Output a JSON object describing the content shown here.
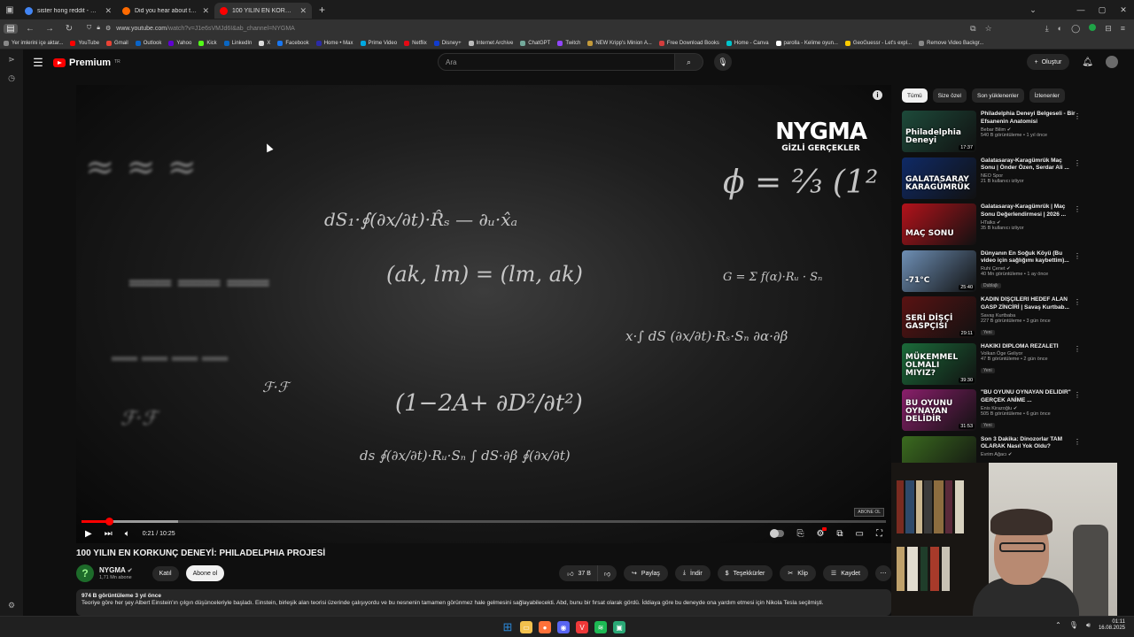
{
  "browser": {
    "tabs": [
      {
        "title": "sister hong reddit - Google Search",
        "favicon_color": "#4285f4",
        "active": false
      },
      {
        "title": "Did you hear about the Sister Hong",
        "favicon_color": "#ff6a00",
        "active": false
      },
      {
        "title": "100 YILIN EN KORKUNÇ DENEYİ",
        "favicon_color": "#ff0000",
        "active": true
      }
    ],
    "url_host": "www.youtube.com",
    "url_path": "/watch?v=J1e6sVMJd6I&ab_channel=NYGMA",
    "bookmarks": [
      {
        "label": "Yer imlerini içe aktar...",
        "color": "#888888"
      },
      {
        "label": "YouTube",
        "color": "#ff0000"
      },
      {
        "label": "Gmail",
        "color": "#ea4335"
      },
      {
        "label": "Outlook",
        "color": "#0a64c8"
      },
      {
        "label": "Yahoo",
        "color": "#6001d2"
      },
      {
        "label": "Kick",
        "color": "#53fc18"
      },
      {
        "label": "LinkedIn",
        "color": "#0a66c2"
      },
      {
        "label": "X",
        "color": "#dddddd"
      },
      {
        "label": "Facebook",
        "color": "#1877f2"
      },
      {
        "label": "Home • Max",
        "color": "#2b2ba8"
      },
      {
        "label": "Prime Video",
        "color": "#00a8e1"
      },
      {
        "label": "Netflix",
        "color": "#e50914"
      },
      {
        "label": "Disney+",
        "color": "#113ccf"
      },
      {
        "label": "Internet Archive",
        "color": "#bbbbbb"
      },
      {
        "label": "ChatGPT",
        "color": "#74aa9c"
      },
      {
        "label": "Twitch",
        "color": "#9146ff"
      },
      {
        "label": "NEW Kripp's Minion A...",
        "color": "#c49a3a"
      },
      {
        "label": "Free Download Books",
        "color": "#d33d3d"
      },
      {
        "label": "Home - Canva",
        "color": "#00c4cc"
      },
      {
        "label": "parolla - Kelime oyun...",
        "color": "#ffffff"
      },
      {
        "label": "GeoGuessr - Let's expl...",
        "color": "#ffcc00"
      },
      {
        "label": "Remove Video Backgr...",
        "color": "#888888"
      }
    ]
  },
  "header": {
    "logo_text": "Premium",
    "logo_region": "TR",
    "search_placeholder": "Ara",
    "create_label": "Oluştur"
  },
  "player": {
    "brand_line1": "NYGMA",
    "brand_line2": "GİZLİ GERÇEKLER",
    "current_time": "0:21",
    "duration": "10:25",
    "time_text": "0:21 / 10:25",
    "played_fraction": 0.034,
    "buffered_fraction": 0.12,
    "corner_tag": "ABONE OL"
  },
  "video": {
    "title": "100 YILIN EN KORKUNÇ DENEYİ: PHILADELPHIA PROJESİ",
    "channel_name": "NYGMA",
    "subscribers": "1,71 Mn abone",
    "join_label": "Katıl",
    "subscribe_label": "Abone ol",
    "likes": "37 B",
    "share_label": "Paylaş",
    "download_label": "İndir",
    "thanks_label": "Teşekkürler",
    "clip_label": "Klip",
    "save_label": "Kaydet",
    "views_date": "974 B görüntüleme  3 yıl önce",
    "description": "Teoriye göre her şey Albert Einstein'ın çılgın düşünceleriyle başladı. Einstein, birleşik alan teorisi üzerinde çalışıyordu ve bu nesnenin tamamen görünmez hale gelmesini sağlayabilecekti. Abd, bunu bir fırsat olarak gördü. İddiaya göre bu deneyde ona yardım etmesi için Nikola Tesla seçilmişti."
  },
  "chips": [
    "Tümü",
    "Size özel",
    "Son yüklenenler",
    "İzlenenler"
  ],
  "recommendations": [
    {
      "title": "Philadelphia Deneyi Belgeseli - Bir Efsanenin Anatomisi",
      "channel": "Bebar Bilim",
      "verified": true,
      "stats": "540 B görüntüleme • 1 yıl önce",
      "duration": "17:37",
      "badge": "",
      "thumb_color": "#1d4a3a",
      "thumb_text": "Philadelphia Deneyi"
    },
    {
      "title": "Galatasaray-Karagümrük Maç Sonu | Önder Özen, Serdar Ali ...",
      "channel": "NEO Spor",
      "verified": false,
      "stats": "21 B kullanıcı izliyor",
      "duration": "",
      "badge": "",
      "thumb_color": "#0f2a66",
      "thumb_text": "GALATASARAY KARAGÜMRÜK"
    },
    {
      "title": "Galatasaray-Karagümrük | Maç Sonu Değerlendirmesi | 2026 ...",
      "channel": "HTalks",
      "verified": true,
      "stats": "35 B kullanıcı izliyor",
      "duration": "",
      "badge": "",
      "thumb_color": "#b3121b",
      "thumb_text": "MAÇ SONU"
    },
    {
      "title": "Dünyanın En Soğuk Köyü (Bu video için sağlığımı kaybettim)...",
      "channel": "Ruhi Çenet",
      "verified": true,
      "stats": "40 Mn görüntüleme • 1 ay önce",
      "duration": "25:40",
      "badge": "Dublajlı",
      "thumb_color": "#6e8fb5",
      "thumb_text": "-71°C"
    },
    {
      "title": "KADIN DİŞÇİLERİ HEDEF ALAN GASP ZİNCİRİ | Savaş Kurtbab...",
      "channel": "Savaş Kurtbaba",
      "verified": false,
      "stats": "227 B görüntüleme • 3 gün önce",
      "duration": "29:11",
      "badge": "Yeni",
      "thumb_color": "#5a1212",
      "thumb_text": "SERİ DİŞÇİ GASPÇISI"
    },
    {
      "title": "HAKİKİ DİPLOMA REZALETİ",
      "channel": "Volkan Öge Geliyor",
      "verified": false,
      "stats": "47 B görüntüleme • 2 gün önce",
      "duration": "39:30",
      "badge": "Yeni",
      "thumb_color": "#1b6b3a",
      "thumb_text": "MÜKEMMEL OLMALI MIYIZ?"
    },
    {
      "title": "\"BU OYUNU OYNAYAN DELİDİR\" GERÇEK ANİME ...",
      "channel": "Enis Kirazoğlu",
      "verified": true,
      "stats": "505 B görüntüleme • 6 gün önce",
      "duration": "31:53",
      "badge": "Yeni",
      "thumb_color": "#8a1f6b",
      "thumb_text": "BU OYUNU OYNAYAN DELİDİR"
    },
    {
      "title": "Son 3 Dakika: Dinozorlar TAM OLARAK Nasıl Yok Oldu?",
      "channel": "Evrim Ağacı",
      "verified": true,
      "stats": "",
      "duration": "",
      "badge": "",
      "thumb_color": "#3b6b1f",
      "thumb_text": ""
    }
  ],
  "taskbar": {
    "time": "01:11",
    "date": "16.08.2025",
    "apps": [
      {
        "name": "windows-start",
        "color": "#2b88d8",
        "glyph": "⊞"
      },
      {
        "name": "file-explorer",
        "color": "#f2c14e",
        "glyph": "▭"
      },
      {
        "name": "firefox",
        "color": "#ff7139",
        "glyph": "●"
      },
      {
        "name": "discord",
        "color": "#5865f2",
        "glyph": "◉"
      },
      {
        "name": "vivaldi",
        "color": "#ef3939",
        "glyph": "V"
      },
      {
        "name": "spotify",
        "color": "#1db954",
        "glyph": "≋"
      },
      {
        "name": "app-green",
        "color": "#2aa876",
        "glyph": "▣"
      }
    ]
  }
}
